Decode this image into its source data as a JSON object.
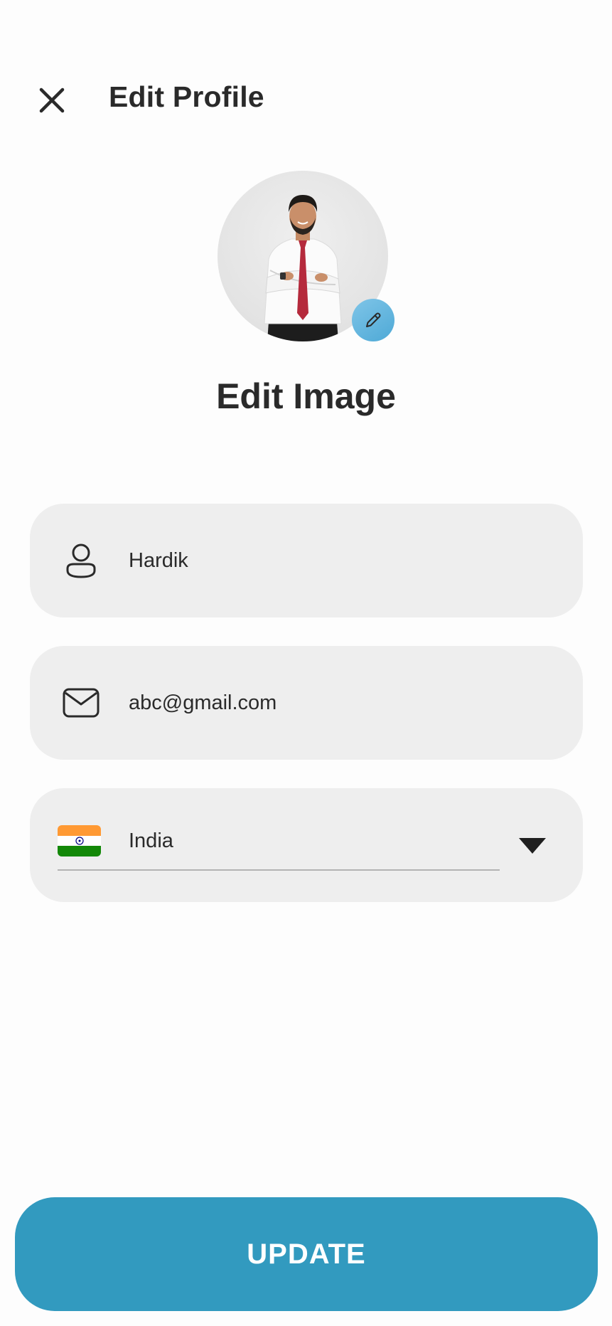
{
  "header": {
    "title": "Edit Profile",
    "close_icon": "close-icon"
  },
  "profile": {
    "avatar_alt": "Profile photo",
    "edit_badge_icon": "pencil-icon",
    "edit_image_label": "Edit Image"
  },
  "form": {
    "name": {
      "icon": "user-icon",
      "value": "Hardik"
    },
    "email": {
      "icon": "mail-icon",
      "value": "abc@gmail.com"
    },
    "country": {
      "flag_icon": "india-flag-icon",
      "value": "India",
      "dropdown_icon": "caret-down-icon"
    }
  },
  "actions": {
    "update_label": "UPDATE"
  },
  "colors": {
    "primary": "#329abf",
    "badge": "#5db3dd",
    "field_bg": "#eeeeee",
    "text": "#2a2a2a"
  }
}
